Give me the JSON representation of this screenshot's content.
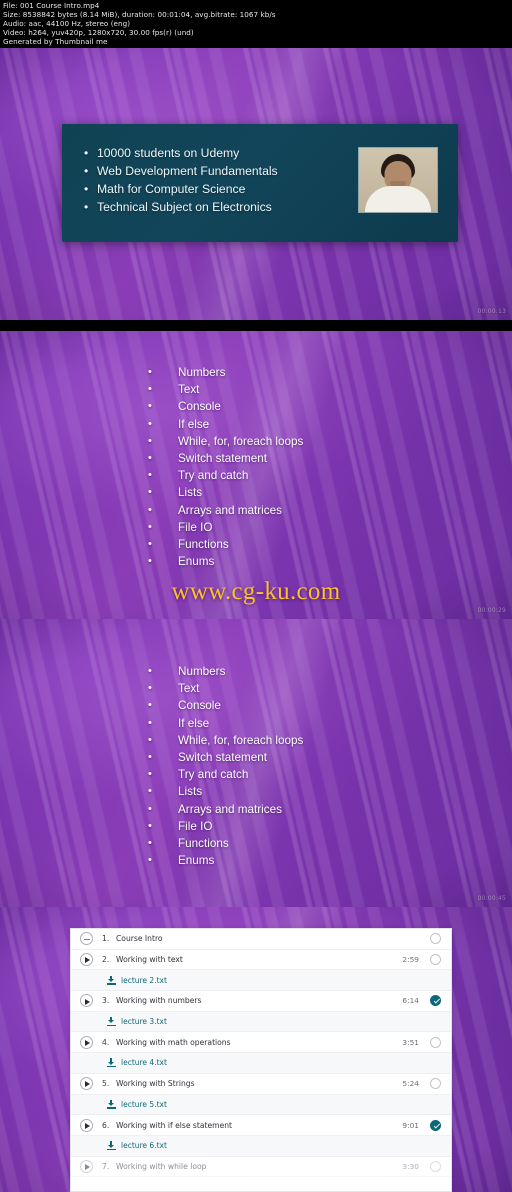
{
  "header": {
    "lines": [
      "File: 001 Course Intro.mp4",
      "Size: 8538842 bytes (8.14 MiB), duration: 00:01:04, avg.bitrate: 1067 kb/s",
      "Audio: aac, 44100 Hz, stereo (eng)",
      "Video: h264, yuv420p, 1280x720, 30.00 fps(r) (und)",
      "Generated by Thumbnail me"
    ]
  },
  "slide_intro": {
    "bullets": [
      "10000 students on Udemy",
      "Web Development Fundamentals",
      "Math for Computer Science",
      "Technical Subject on Electronics"
    ],
    "portrait_alt": "instructor-portrait"
  },
  "slide_topics": {
    "bullets": [
      "Numbers",
      "Text",
      "Console",
      "If else",
      "While, for, foreach loops",
      "Switch statement",
      "Try and catch",
      "Lists",
      "Arrays and matrices",
      "File IO",
      "Functions",
      "Enums"
    ]
  },
  "watermark": "www.cg-ku.com",
  "timestamps": [
    "00:00:13",
    "00:00:29",
    "00:00:45"
  ],
  "curriculum": {
    "rows": [
      {
        "kind": "lecture",
        "icon": "dash",
        "num": "1.",
        "title": "Course Intro",
        "duration": "",
        "status": "pending"
      },
      {
        "kind": "lecture",
        "icon": "play",
        "num": "2.",
        "title": "Working with text",
        "duration": "2:59",
        "status": "pending"
      },
      {
        "kind": "attach",
        "title": "lecture 2.txt"
      },
      {
        "kind": "lecture",
        "icon": "play",
        "num": "3.",
        "title": "Working with numbers",
        "duration": "6:14",
        "status": "done"
      },
      {
        "kind": "attach",
        "title": "lecture 3.txt"
      },
      {
        "kind": "lecture",
        "icon": "play",
        "num": "4.",
        "title": "Working with math operations",
        "duration": "3:51",
        "status": "pending"
      },
      {
        "kind": "attach",
        "title": "lecture 4.txt"
      },
      {
        "kind": "lecture",
        "icon": "play",
        "num": "5.",
        "title": "Working with Strings",
        "duration": "5:24",
        "status": "pending"
      },
      {
        "kind": "attach",
        "title": "lecture 5.txt"
      },
      {
        "kind": "lecture",
        "icon": "play",
        "num": "6.",
        "title": "Working with if else statement",
        "duration": "9:01",
        "status": "done"
      },
      {
        "kind": "attach",
        "title": "lecture 6.txt"
      },
      {
        "kind": "lecture",
        "icon": "play",
        "num": "7.",
        "title": "Working with while loop",
        "duration": "3:30",
        "status": "pending",
        "cut": true
      }
    ]
  },
  "colors": {
    "accent_teal": "#0c6878",
    "card_teal": "#0f4353",
    "watermark_gold": "#fbc02d",
    "bg_purple": "#7b35ae"
  }
}
